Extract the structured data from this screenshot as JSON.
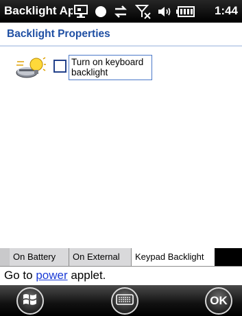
{
  "status_bar": {
    "app_title": "Backlight Appl",
    "time": "1:44"
  },
  "page": {
    "title": "Backlight Properties"
  },
  "content": {
    "checkbox_label": "Turn on keyboard backlight",
    "checkbox_checked": false
  },
  "tabs": [
    {
      "label": "On Battery",
      "selected": false
    },
    {
      "label": "On External",
      "selected": false
    },
    {
      "label": "Keypad Backlight",
      "selected": true
    }
  ],
  "power_line": {
    "prefix": "Go to ",
    "link": "power",
    "suffix": " applet."
  },
  "softkeys": {
    "ok_label": "OK"
  },
  "colors": {
    "title_blue": "#1f4fa3",
    "link_blue": "#1a3bd6"
  }
}
